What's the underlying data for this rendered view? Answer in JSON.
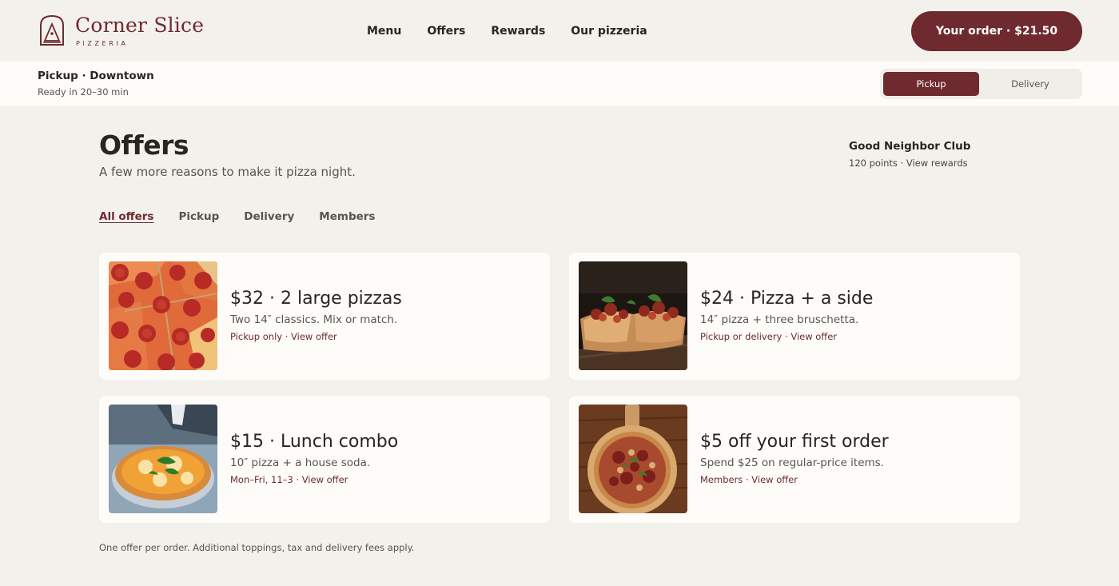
{
  "brand": {
    "name": "Corner Slice",
    "tagline": "PIZZERIA",
    "accent": "#6e2a2e"
  },
  "nav": {
    "items": [
      "Menu",
      "Offers",
      "Rewards",
      "Our pizzeria"
    ]
  },
  "order_button": {
    "label": "Your order · $21.50"
  },
  "location": {
    "title": "Pickup · Downtown",
    "ready": "Ready in 20–30 min",
    "modes": [
      "Pickup",
      "Delivery"
    ],
    "selected": "Pickup"
  },
  "page": {
    "title": "Offers",
    "subtitle": "A few more reasons to make it pizza night."
  },
  "club": {
    "name": "Good Neighbor Club",
    "points": "120 points · View rewards"
  },
  "filters": [
    "All offers",
    "Pickup",
    "Delivery",
    "Members"
  ],
  "offers": [
    {
      "title": "$32 · 2 large pizzas",
      "desc": "Two 14″ classics. Mix or match.",
      "availability": "Pickup only",
      "link": "View offer",
      "image": "pepperoni-pizza"
    },
    {
      "title": "$24 · Pizza + a side",
      "desc": "14″ pizza + three bruschetta.",
      "availability": "Pickup or delivery",
      "link": "View offer",
      "image": "bruschetta"
    },
    {
      "title": "$15 · Lunch combo",
      "desc": "10″ pizza + a house soda.",
      "availability": "Mon–Fri, 11–3",
      "link": "View offer",
      "image": "margherita-pizza"
    },
    {
      "title": "$5 off your first order",
      "desc": "Spend $25 on regular-price items.",
      "availability": "Members",
      "link": "View offer",
      "image": "pizza-on-peel"
    }
  ],
  "footnote": "One offer per order. Additional toppings, tax and delivery fees apply."
}
